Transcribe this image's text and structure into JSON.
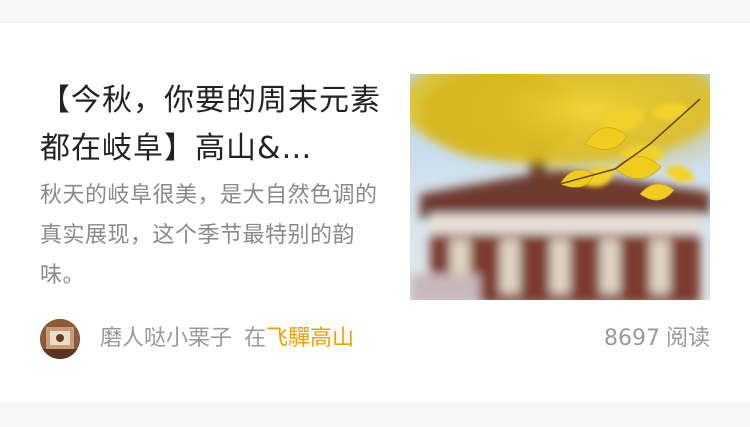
{
  "article": {
    "title": "【今秋，你要的周末元素都在岐阜】高山&…",
    "description": "秋天的岐阜很美，是大自然色调的真实展现，这个季节最特别的韵味。",
    "thumbnail_icon": "ginkgo-pagoda-photo",
    "author": {
      "name": "磨人哒小栗子",
      "avatar_icon": "user-avatar",
      "location_prefix": "在",
      "location": "飞驒高山"
    },
    "read_count": "8697",
    "read_label": "阅读"
  },
  "colors": {
    "title": "#222222",
    "description": "#8a8a8a",
    "meta": "#9a9a9a",
    "location_accent": "#f2a000",
    "card_background": "#ffffff",
    "page_background": "#f6f6f6"
  }
}
